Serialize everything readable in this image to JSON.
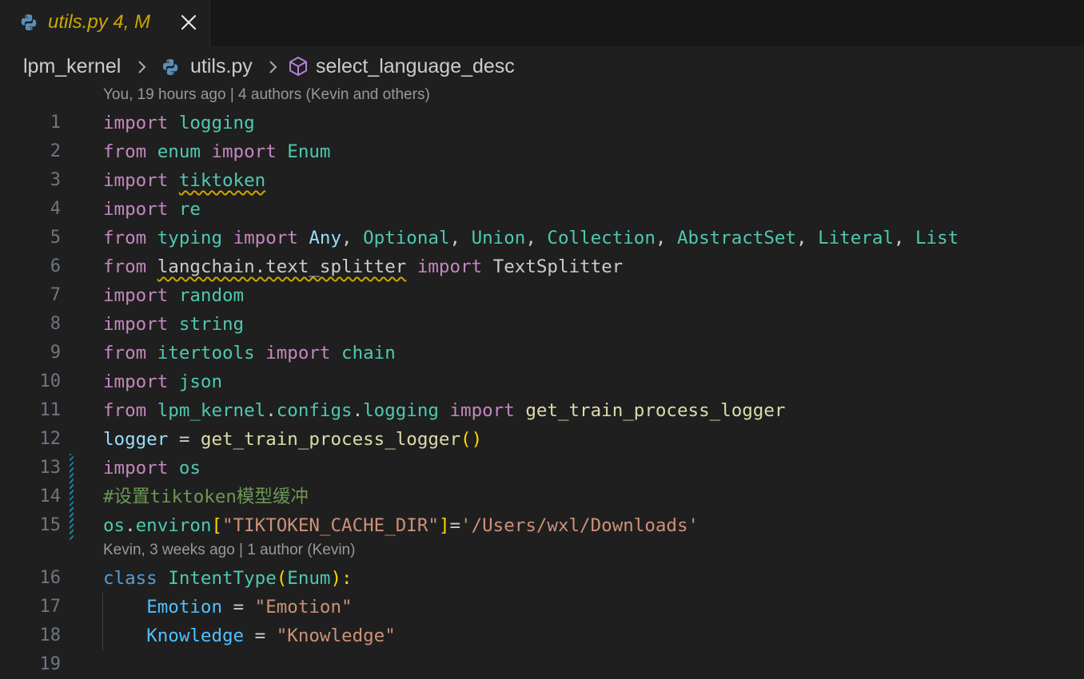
{
  "tab": {
    "title": "utils.py",
    "badge": "4, M",
    "icon": "python-icon",
    "close_icon": "close-icon"
  },
  "breadcrumb": {
    "items": [
      "lpm_kernel",
      "utils.py",
      "select_language_desc"
    ],
    "icons": [
      "python-icon",
      "symbol-method-icon"
    ]
  },
  "codelens": [
    "You, 19 hours ago | 4 authors (Kevin and others)",
    "Kevin, 3 weeks ago | 1 author (Kevin)"
  ],
  "colors": {
    "keyword": "#c586c0",
    "module": "#4ec9b0",
    "function": "#dcdcaa",
    "variable": "#9cdcfe",
    "string": "#ce9178",
    "comment": "#6a9955",
    "warning": "#cca700"
  },
  "lines": [
    {
      "n": "1",
      "t": [
        "import",
        " ",
        "logging"
      ]
    },
    {
      "n": "2",
      "t": [
        "from",
        " ",
        "enum",
        " ",
        "import",
        " ",
        "Enum"
      ]
    },
    {
      "n": "3",
      "t": [
        "import",
        " ",
        "tiktoken"
      ]
    },
    {
      "n": "4",
      "t": [
        "import",
        " ",
        "re"
      ]
    },
    {
      "n": "5",
      "t": [
        "from",
        " ",
        "typing",
        " ",
        "import",
        " ",
        "Any",
        ", ",
        "Optional",
        ", ",
        "Union",
        ", ",
        "Collection",
        ", ",
        "AbstractSet",
        ", ",
        "Literal",
        ", ",
        "List"
      ]
    },
    {
      "n": "6",
      "t": [
        "from",
        " ",
        "langchain.text_splitter",
        " ",
        "import",
        " ",
        "TextSplitter"
      ]
    },
    {
      "n": "7",
      "t": [
        "import",
        " ",
        "random"
      ]
    },
    {
      "n": "8",
      "t": [
        "import",
        " ",
        "string"
      ]
    },
    {
      "n": "9",
      "t": [
        "from",
        " ",
        "itertools",
        " ",
        "import",
        " ",
        "chain"
      ]
    },
    {
      "n": "10",
      "t": [
        "import",
        " ",
        "json"
      ]
    },
    {
      "n": "11",
      "t": [
        "from",
        " ",
        "lpm_kernel",
        ".",
        "configs",
        ".",
        "logging",
        " ",
        "import",
        " ",
        "get_train_process_logger"
      ]
    },
    {
      "n": "12",
      "t": [
        "logger",
        " = ",
        "get_train_process_logger",
        "()"
      ]
    },
    {
      "n": "13",
      "t": [
        "import",
        " ",
        "os"
      ]
    },
    {
      "n": "14",
      "t": [
        "#设置tiktoken模型缓冲"
      ]
    },
    {
      "n": "15",
      "t": [
        "os",
        ".",
        "environ",
        "[",
        "\"TIKTOKEN_CACHE_DIR\"",
        "]",
        "=",
        "'/Users/wxl/Downloads'"
      ]
    },
    {
      "n": "16",
      "t": [
        "class",
        " ",
        "IntentType",
        "(",
        "Enum",
        "):"
      ]
    },
    {
      "n": "17",
      "t": [
        "    ",
        "Emotion",
        " = ",
        "\"Emotion\""
      ]
    },
    {
      "n": "18",
      "t": [
        "    ",
        "Knowledge",
        " = ",
        "\"Knowledge\""
      ]
    },
    {
      "n": "19",
      "t": []
    }
  ]
}
